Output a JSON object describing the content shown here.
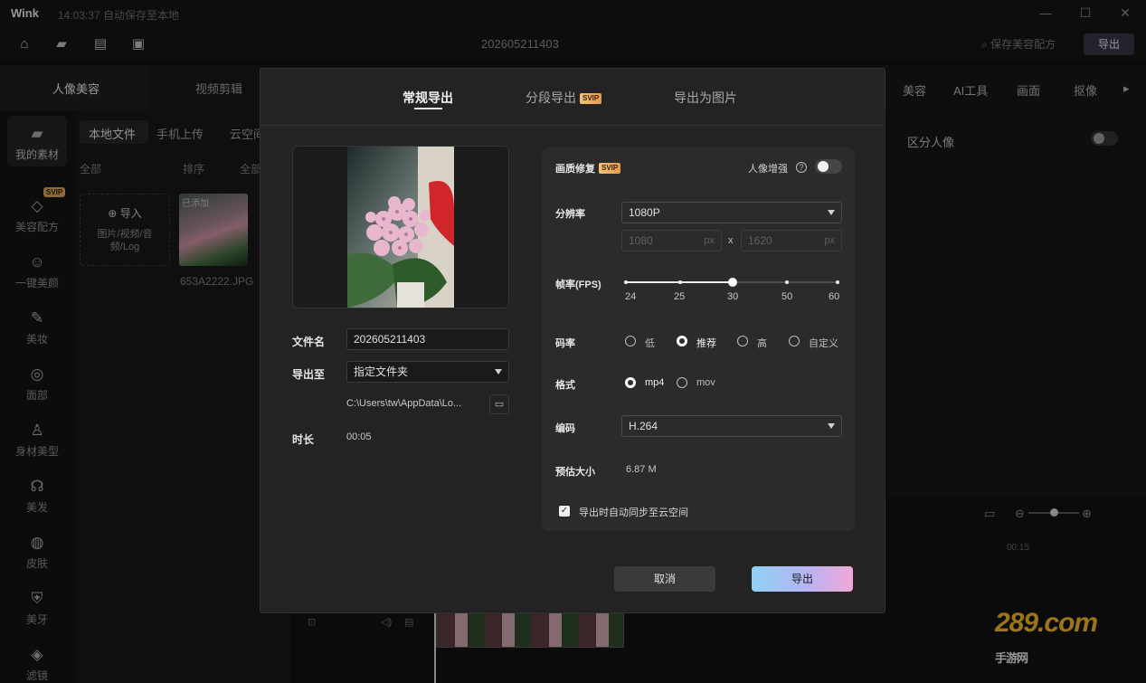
{
  "app": {
    "name": "Wink",
    "autosave_status": "14:03:37 自动保存至本地",
    "project_name": "202605211403",
    "save_preset_label": "保存美容配方",
    "export_label": "导出"
  },
  "main_tabs": [
    {
      "label": "人像美容"
    },
    {
      "label": "视频剪辑"
    }
  ],
  "right_tabs": [
    {
      "label": "美容"
    },
    {
      "label": "AI工具"
    },
    {
      "label": "画面"
    },
    {
      "label": "抠像"
    }
  ],
  "right_panel": {
    "distinguish_label": "区分人像"
  },
  "sidebar": {
    "items": [
      {
        "label": "我的素材",
        "icon": "folder-icon"
      },
      {
        "label": "美容配方",
        "icon": "layers-icon",
        "badge": "SVIP"
      },
      {
        "label": "一键美颜",
        "icon": "face-icon"
      },
      {
        "label": "美妆",
        "icon": "makeup-brush-icon"
      },
      {
        "label": "面部",
        "icon": "face-outline-icon"
      },
      {
        "label": "身材美型",
        "icon": "body-icon"
      },
      {
        "label": "美发",
        "icon": "hair-icon"
      },
      {
        "label": "皮肤",
        "icon": "skin-icon"
      },
      {
        "label": "美牙",
        "icon": "tooth-icon"
      },
      {
        "label": "滤镜",
        "icon": "filter-icon"
      }
    ]
  },
  "library": {
    "tabs": [
      {
        "label": "本地文件"
      },
      {
        "label": "手机上传"
      },
      {
        "label": "云空间"
      }
    ],
    "filter_all": "全部",
    "sort_label": "排序",
    "filter_all_2": "全部",
    "import_label": "导入",
    "import_hint": "图片/视频/音频/Log",
    "added_badge": "已添加",
    "file_name": "653A2222.JPG"
  },
  "timeline": {
    "time_marker": "00:15"
  },
  "watermark": {
    "text": "289.com",
    "subtext": "手游网"
  },
  "dialog": {
    "tabs": [
      {
        "label": "常规导出",
        "active": true
      },
      {
        "label": "分段导出",
        "badge": "SVIP",
        "active": false
      },
      {
        "label": "导出为图片",
        "active": false
      }
    ],
    "filename_label": "文件名",
    "filename_value": "202605211403",
    "export_to_label": "导出至",
    "export_to_value": "指定文件夹",
    "path_value": "C:\\Users\\tw\\AppData\\Lo...",
    "duration_label": "时长",
    "duration_value": "00:05",
    "quality_label": "画质修复",
    "quality_badge": "SVIP",
    "portrait_enhance_label": "人像增强",
    "portrait_enhance_on": false,
    "resolution_label": "分辨率",
    "resolution_value": "1080P",
    "width_value": "1080",
    "height_value": "1620",
    "unit_px": "px",
    "x_sep": "x",
    "fps_label": "帧率(FPS)",
    "fps_options": [
      "24",
      "25",
      "30",
      "50",
      "60"
    ],
    "fps_selected": "30",
    "bitrate_label": "码率",
    "bitrate_options": [
      {
        "label": "低",
        "checked": false
      },
      {
        "label": "推荐",
        "checked": true
      },
      {
        "label": "高",
        "checked": false
      },
      {
        "label": "自定义",
        "checked": false
      }
    ],
    "format_label": "格式",
    "format_options": [
      {
        "label": "mp4",
        "checked": true
      },
      {
        "label": "mov",
        "checked": false
      }
    ],
    "codec_label": "编码",
    "codec_value": "H.264",
    "est_size_label": "预估大小",
    "est_size_value": "6.87 M",
    "sync_label": "导出时自动同步至云空间",
    "sync_checked": true,
    "cancel_label": "取消",
    "export_label": "导出"
  },
  "colors": {
    "accent_gradient_start": "#8fd3f4",
    "accent_gradient_end": "#f1a9d8",
    "svip_badge": "#e29a4f",
    "dialog_bg": "#232324"
  }
}
